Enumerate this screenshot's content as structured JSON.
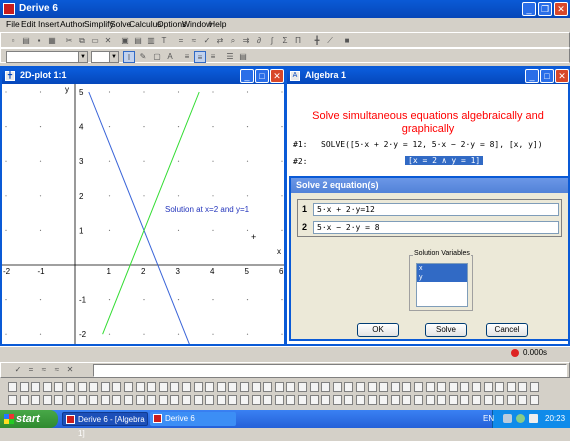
{
  "app": {
    "title": "Derive 6"
  },
  "menu": [
    "File",
    "Edit",
    "Insert",
    "Author",
    "Simplify",
    "Solve",
    "Calculus",
    "Options",
    "Window",
    "Help"
  ],
  "plot_window": {
    "title": "2D-plot 1:1",
    "annotation": "Solution at x=2 and y=1",
    "x_axis_label": "x",
    "y_axis_label": "y",
    "x_ticks": [
      "-2",
      "-1",
      "1",
      "2",
      "3",
      "4",
      "5",
      "6"
    ],
    "y_ticks": [
      "5",
      "4",
      "3",
      "2",
      "1",
      "-1",
      "-2"
    ],
    "line_colors": {
      "line1": "#3a64d8",
      "line2": "#33dd33"
    },
    "cursor_glyph": "+"
  },
  "chart_data": {
    "type": "line",
    "xlim": [
      -2,
      6
    ],
    "ylim": [
      -2.5,
      5.2
    ],
    "grid": "dots",
    "series": [
      {
        "equation": "5x + 2y = 12",
        "color": "#3a64d8",
        "x": [
          0.4,
          3.6
        ],
        "y": [
          5,
          -3
        ]
      },
      {
        "equation": "5x - 2y = 8",
        "color": "#33dd33",
        "x": [
          0.8,
          3.6
        ],
        "y": [
          -2,
          5
        ]
      }
    ],
    "annotation": "Solution at x=2 and y=1"
  },
  "algebra_window": {
    "title": "Algebra 1",
    "heading_line1": "Solve simultaneous equations algebraically and",
    "heading_line2": "graphically",
    "expr1_label": "#1:",
    "expr1": "SOLVE([5·x + 2·y = 12, 5·x − 2·y = 8], [x, y])",
    "expr2_label": "#2:",
    "expr2": "[x = 2 ∧ y = 1]"
  },
  "dialog": {
    "title": "Solve 2 equation(s)",
    "eq1_num": "1",
    "eq1": "5·x + 2·y=12",
    "eq2_num": "2",
    "eq2": "5·x − 2·y = 8",
    "vars_group_label": "Solution Variables",
    "variables": [
      "x",
      "y"
    ],
    "ok_label": "OK",
    "solve_label": "Solve",
    "cancel_label": "Cancel"
  },
  "status": {
    "time": "0.000s"
  },
  "taskbar": {
    "start_label": "start",
    "task1": "Derive 6 - [Algebra 1]",
    "task2": "Derive 6",
    "lang": "EN",
    "clock": "20:23"
  }
}
